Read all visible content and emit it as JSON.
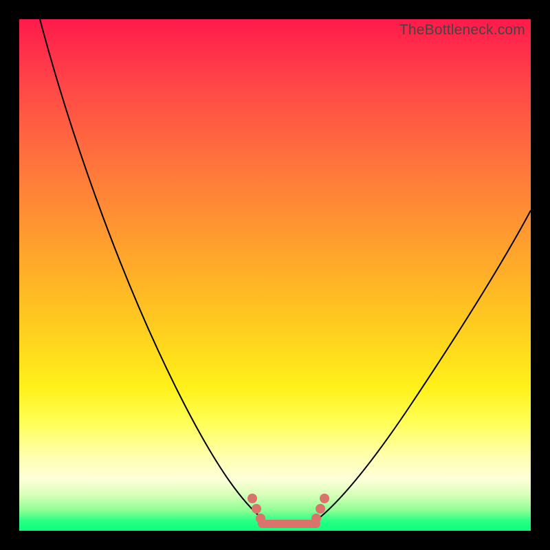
{
  "watermark": "TheBottleneck.com",
  "colors": {
    "frame": "#000000",
    "watermark_text": "#444444",
    "curve": "#000000",
    "marker": "#d9736b",
    "gradient_top": "#ff1a4b",
    "gradient_bottom": "#0bff7e"
  },
  "chart_data": {
    "type": "line",
    "title": "",
    "xlabel": "",
    "ylabel": "",
    "xlim": [
      0,
      100
    ],
    "ylim": [
      0,
      100
    ],
    "series": [
      {
        "name": "left-curve",
        "x": [
          4,
          10,
          18,
          26,
          34,
          40,
          45,
          49
        ],
        "y": [
          100,
          77,
          55,
          35,
          18,
          8,
          2,
          0
        ]
      },
      {
        "name": "right-curve",
        "x": [
          57,
          62,
          68,
          76,
          84,
          92,
          100
        ],
        "y": [
          0,
          4,
          11,
          22,
          35,
          49,
          63
        ]
      },
      {
        "name": "flat-bottom",
        "x": [
          47,
          58
        ],
        "y": [
          0,
          0
        ]
      }
    ],
    "markers": [
      {
        "x": 45.5,
        "y": 5
      },
      {
        "x": 46.3,
        "y": 3
      },
      {
        "x": 47.1,
        "y": 1
      },
      {
        "x": 58.0,
        "y": 1
      },
      {
        "x": 58.8,
        "y": 3
      },
      {
        "x": 59.6,
        "y": 5
      }
    ],
    "annotations": []
  }
}
